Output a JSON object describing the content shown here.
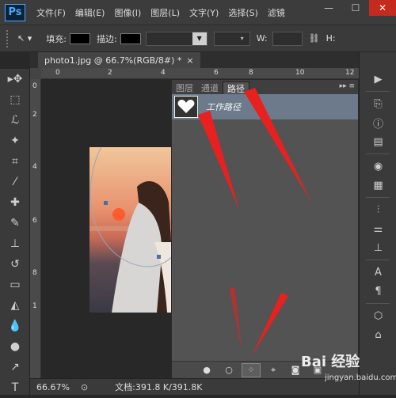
{
  "app": {
    "logo": "Ps"
  },
  "menu": [
    "文件(F)",
    "编辑(E)",
    "图像(I)",
    "图层(L)",
    "文字(Y)",
    "选择(S)",
    "滤镜"
  ],
  "window_controls": {
    "minimize": "—",
    "maximize": "☐",
    "close": "✕"
  },
  "options": {
    "fill_label": "填充:",
    "stroke_label": "描边:",
    "w_label": "W:",
    "h_label": "H:"
  },
  "document": {
    "tab_title": "photo1.jpg @ 66.7%(RGB/8#) *",
    "tab_close": "×"
  },
  "ruler_h": [
    "0",
    "2",
    "4",
    "6",
    "8",
    "10",
    "12"
  ],
  "ruler_v": [
    "0",
    "2",
    "4",
    "6",
    "8",
    "1"
  ],
  "status": {
    "zoom": "66.67%",
    "doc_info": "文档:391.8 K/391.8K"
  },
  "panel": {
    "tabs": [
      "图层",
      "通道",
      "路径"
    ],
    "active_tab": "路径",
    "menu_glyph": "▸▸ ≡",
    "path_name": "工作路径",
    "bottom_buttons": [
      "●",
      "○",
      "⁘",
      "⌖",
      "◙",
      "▣",
      "🗑"
    ]
  },
  "tools": [
    "move-tool",
    "marquee-tool",
    "lasso-tool",
    "magic-wand-tool",
    "crop-tool",
    "eyedropper-tool",
    "healing-tool",
    "brush-tool",
    "stamp-tool",
    "history-brush-tool",
    "eraser-tool",
    "bucket-tool",
    "blur-tool",
    "dodge-tool",
    "pen-tool",
    "type-tool"
  ],
  "right_icons": [
    "play-icon",
    "history-icon",
    "info-icon",
    "navigator-icon",
    "color-icon",
    "swatches-icon",
    "brushes-icon",
    "adjustments-icon",
    "clone-source-icon",
    "character-icon",
    "paragraph-icon",
    "3d-icon",
    "tool-presets-icon"
  ],
  "watermark": {
    "text": "Bai 经验",
    "sub": "jingyan.baidu.com"
  },
  "colors": {
    "accent": "#4da6ff",
    "selection": "#6c7a8c",
    "arrow": "#e82020"
  }
}
